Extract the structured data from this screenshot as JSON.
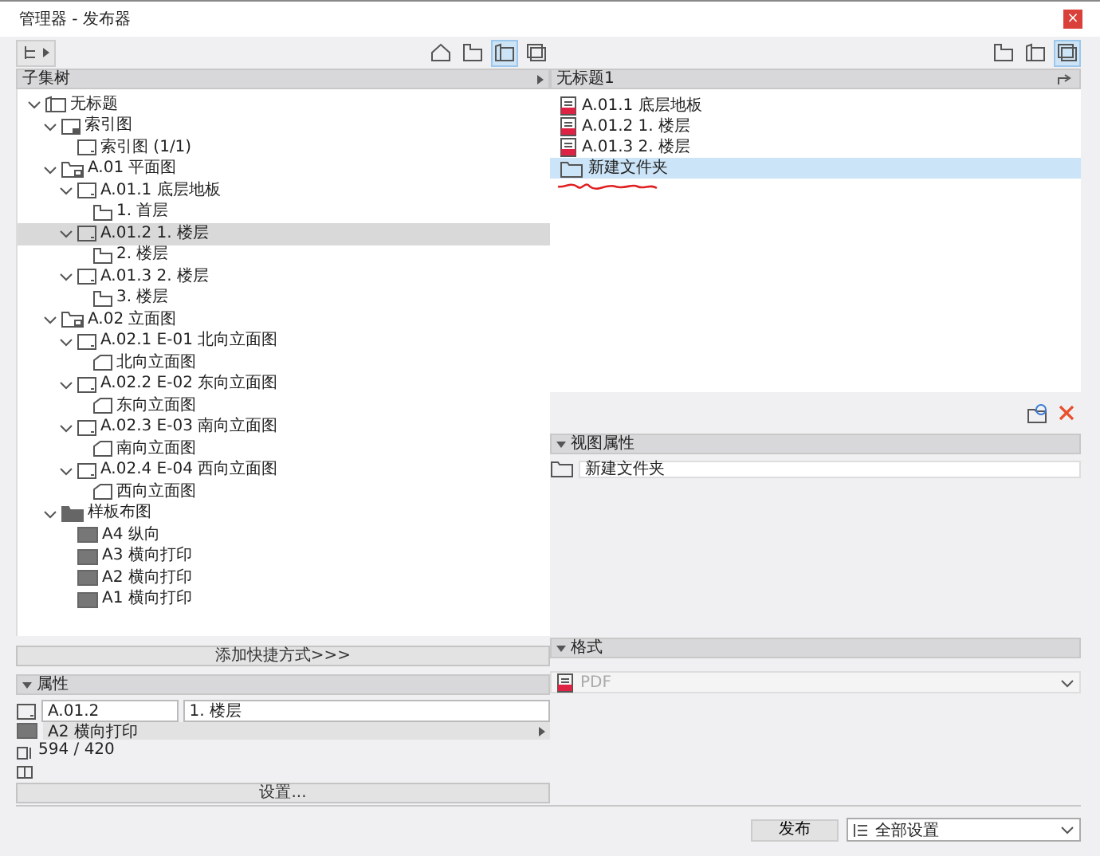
{
  "window": {
    "title": "管理器 - 发布器",
    "close": "×"
  },
  "left": {
    "toolbar": {
      "views": [
        {
          "kind": "house",
          "selected": false
        },
        {
          "kind": "story",
          "selected": false
        },
        {
          "kind": "sheet",
          "selected": true
        },
        {
          "kind": "publish",
          "selected": false
        }
      ]
    },
    "header": {
      "title": "子集树"
    },
    "tree": [
      {
        "kind": "book",
        "label": "无标题",
        "expanded": true,
        "selected": false,
        "children": [
          {
            "kind": "index",
            "label": "索引图",
            "expanded": true,
            "selected": false,
            "children": [
              {
                "kind": "sheet",
                "label": "索引图 (1/1)",
                "selected": false
              }
            ]
          },
          {
            "kind": "subset",
            "label": "A.01 平面图",
            "expanded": true,
            "selected": false,
            "children": [
              {
                "kind": "sheet",
                "label": "A.01.1 底层地板",
                "expanded": true,
                "selected": false,
                "children": [
                  {
                    "kind": "story",
                    "label": "1. 首层",
                    "selected": false
                  }
                ]
              },
              {
                "kind": "sheet",
                "label": "A.01.2 1. 楼层",
                "expanded": true,
                "selected": true,
                "children": [
                  {
                    "kind": "story",
                    "label": "2. 楼层",
                    "selected": false
                  }
                ]
              },
              {
                "kind": "sheet",
                "label": "A.01.3 2. 楼层",
                "expanded": true,
                "selected": false,
                "children": [
                  {
                    "kind": "story",
                    "label": "3. 楼层",
                    "selected": false
                  }
                ]
              }
            ]
          },
          {
            "kind": "subset",
            "label": "A.02 立面图",
            "expanded": true,
            "selected": false,
            "children": [
              {
                "kind": "sheet",
                "label": "A.02.1 E-01 北向立面图",
                "expanded": true,
                "selected": false,
                "children": [
                  {
                    "kind": "elevation",
                    "label": "北向立面图",
                    "selected": false
                  }
                ]
              },
              {
                "kind": "sheet",
                "label": "A.02.2 E-02 东向立面图",
                "expanded": true,
                "selected": false,
                "children": [
                  {
                    "kind": "elevation",
                    "label": "东向立面图",
                    "selected": false
                  }
                ]
              },
              {
                "kind": "sheet",
                "label": "A.02.3 E-03 南向立面图",
                "expanded": true,
                "selected": false,
                "children": [
                  {
                    "kind": "elevation",
                    "label": "南向立面图",
                    "selected": false
                  }
                ]
              },
              {
                "kind": "sheet",
                "label": "A.02.4 E-04 西向立面图",
                "expanded": true,
                "selected": false,
                "children": [
                  {
                    "kind": "elevation",
                    "label": "西向立面图",
                    "selected": false
                  }
                ]
              }
            ]
          },
          {
            "kind": "master-folder",
            "label": "样板布图",
            "expanded": true,
            "selected": false,
            "children": [
              {
                "kind": "master",
                "label": "A4 纵向",
                "selected": false
              },
              {
                "kind": "master",
                "label": "A3 横向打印",
                "selected": false
              },
              {
                "kind": "master",
                "label": "A2 横向打印",
                "selected": false
              },
              {
                "kind": "master",
                "label": "A1 横向打印",
                "selected": false
              }
            ]
          }
        ]
      }
    ],
    "shortcut_button": "添加快捷方式>>>",
    "properties": {
      "title": "属性",
      "id": "A.01.2",
      "name": "1. 楼层",
      "layout": "A2 横向打印",
      "size": "594 / 420",
      "settings_button": "设置..."
    }
  },
  "right": {
    "toolbar": {
      "views": [
        {
          "kind": "story",
          "selected": false
        },
        {
          "kind": "sheet",
          "selected": false
        },
        {
          "kind": "publish",
          "selected": true
        }
      ]
    },
    "header": {
      "title": "无标题1"
    },
    "items": [
      {
        "kind": "pdf",
        "label": "A.01.1 底层地板",
        "selected": false
      },
      {
        "kind": "pdf",
        "label": "A.01.2 1. 楼层",
        "selected": false
      },
      {
        "kind": "pdf",
        "label": "A.01.3 2. 楼层",
        "selected": false
      },
      {
        "kind": "folder",
        "label": "新建文件夹",
        "selected": true
      }
    ],
    "view_properties": {
      "title": "视图属性",
      "name": "新建文件夹"
    },
    "format": {
      "title": "格式",
      "value": "PDF",
      "disabled": true
    }
  },
  "footer": {
    "publish_button": "发布",
    "settings_select": "全部设置"
  }
}
